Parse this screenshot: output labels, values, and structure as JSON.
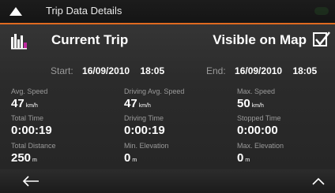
{
  "header": {
    "title": "Trip Data Details"
  },
  "trip": {
    "name": "Current Trip",
    "visible_label": "Visible on Map",
    "visible_checked": true
  },
  "times": {
    "start_label": "Start:",
    "start_date": "16/09/2010",
    "start_time": "18:05",
    "end_label": "End:",
    "end_date": "16/09/2010",
    "end_time": "18:05"
  },
  "stats": {
    "avg_speed": {
      "label": "Avg. Speed",
      "value": "47",
      "unit": "km/h"
    },
    "driving_avg_speed": {
      "label": "Driving Avg. Speed",
      "value": "47",
      "unit": "km/h"
    },
    "max_speed": {
      "label": "Max. Speed",
      "value": "50",
      "unit": "km/h"
    },
    "total_time": {
      "label": "Total Time",
      "value": "0:00:19"
    },
    "driving_time": {
      "label": "Driving Time",
      "value": "0:00:19"
    },
    "stopped_time": {
      "label": "Stopped Time",
      "value": "0:00:00"
    },
    "total_distance": {
      "label": "Total Distance",
      "value": "250",
      "unit": "m"
    },
    "min_elevation": {
      "label": "Min. Elevation",
      "value": "0",
      "unit": "m"
    },
    "max_elevation": {
      "label": "Max. Elevation",
      "value": "0",
      "unit": "m"
    }
  },
  "icons": {
    "header_left": "collapse-up-icon",
    "trip": "trip-chart-icon",
    "checkbox": "checkmark-icon",
    "nav_back": "back-arrow-icon",
    "nav_up": "chevron-up-icon"
  },
  "colors": {
    "accent": "#e06a20",
    "trip_icon_accent": "#c02aa0"
  }
}
